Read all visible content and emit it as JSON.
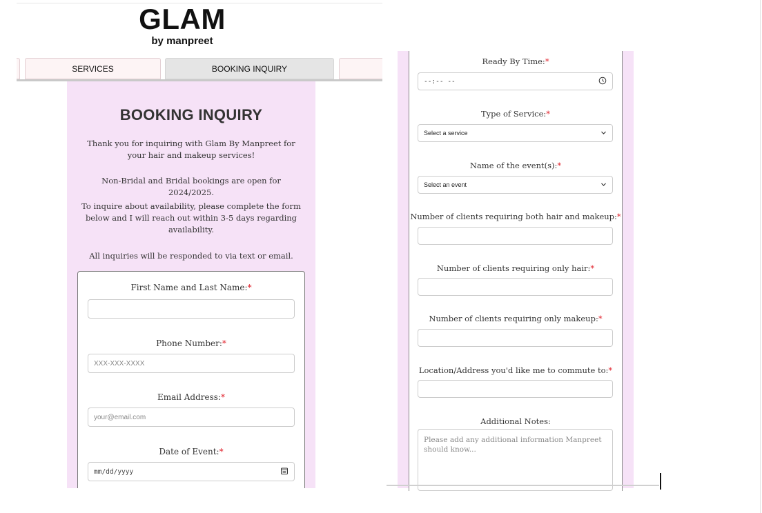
{
  "brand": {
    "title": "GLAM",
    "subtitle": "by manpreet"
  },
  "nav": {
    "tabs": [
      {
        "label": "SERVICES"
      },
      {
        "label": "BOOKING INQUIRY"
      }
    ]
  },
  "booking": {
    "heading": "BOOKING INQUIRY",
    "intro": [
      "Thank you for inquiring with Glam By Manpreet for your hair and makeup services!",
      "Non-Bridal and Bridal bookings are open for 2024/2025.",
      "To inquire about availability, please complete the form below and I will reach out within 3-5 days regarding availability.",
      "All inquiries will be responded to via text or email."
    ]
  },
  "required_mark": "*",
  "form_left": {
    "name_label": "First Name and Last Name:",
    "name_value": "",
    "phone_label": "Phone Number:",
    "phone_placeholder": "XXX-XXX-XXXX",
    "email_label": "Email Address:",
    "email_placeholder": "your@email.com",
    "date_label": "Date of Event:",
    "date_placeholder": "mm/dd/yyyy"
  },
  "form_right": {
    "ready_time_label": "Ready By Time:",
    "ready_time_placeholder": "--:-- --",
    "service_label": "Type of Service:",
    "service_selected": "Select a service",
    "event_label": "Name of the event(s):",
    "event_selected": "Select an event",
    "both_label": "Number of clients requiring both hair and makeup:",
    "hair_label": "Number of clients requiring only hair:",
    "makeup_label": "Number of clients requiring only makeup:",
    "location_label": "Location/Address you'd like me to commute to:",
    "notes_label": "Additional Notes:",
    "notes_placeholder": "Please add any additional information Manpreet should know..."
  },
  "icons": {
    "time": "clock-icon",
    "date": "calendar-icon",
    "dropdown": "chevron-down-icon"
  }
}
